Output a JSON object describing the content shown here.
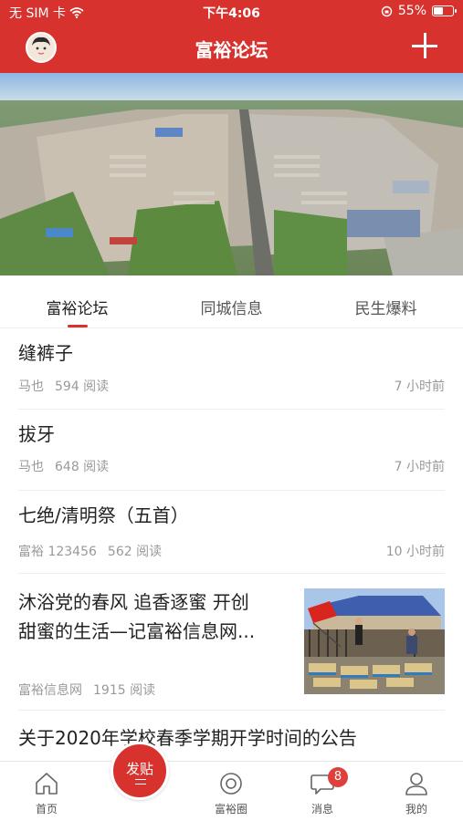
{
  "status": {
    "carrier": "无 SIM 卡",
    "time": "下午4:06",
    "battery_text": "55%",
    "battery_level": 0.55
  },
  "header": {
    "title": "富裕论坛"
  },
  "tabs": [
    {
      "label": "富裕论坛",
      "active": true
    },
    {
      "label": "同城信息",
      "active": false
    },
    {
      "label": "民生爆料",
      "active": false
    }
  ],
  "posts": [
    {
      "title": "缝裤子",
      "author": "马也",
      "reads": "594 阅读",
      "time": "7 小时前"
    },
    {
      "title": "拔牙",
      "author": "马也",
      "reads": "648 阅读",
      "time": "7 小时前"
    },
    {
      "title": "七绝/清明祭（五首）",
      "author": "富裕 123456",
      "reads": "562 阅读",
      "time": "10 小时前"
    },
    {
      "title_line1": "沐浴党的春风 追香逐蜜 开创",
      "title_line2": "甜蜜的生活—记富裕信息网...",
      "author": "富裕信息网",
      "reads": "1915 阅读"
    },
    {
      "title": "关于2020年学校春季学期开学时间的公告"
    }
  ],
  "bottom_nav": {
    "home": "首页",
    "post": "发贴",
    "circle": "富裕圈",
    "messages": "消息",
    "messages_badge": "8",
    "mine": "我的"
  }
}
